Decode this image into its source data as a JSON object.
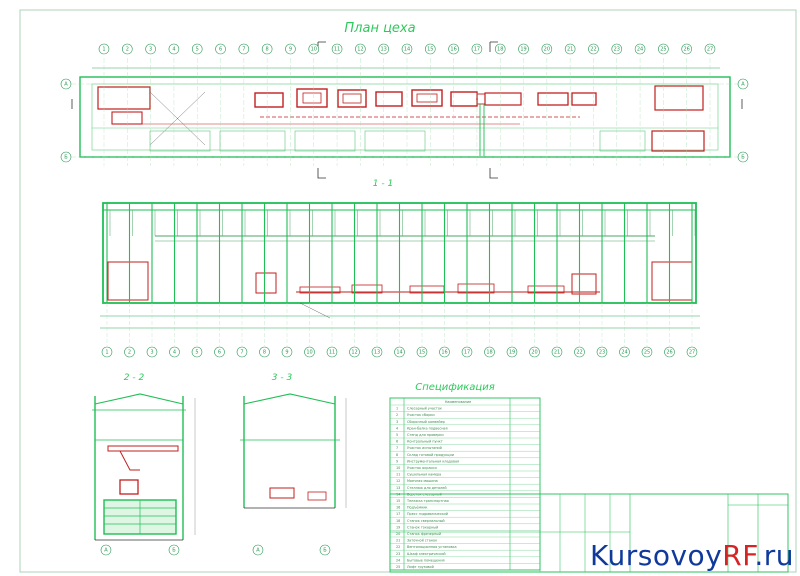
{
  "drawing": {
    "plan_title": "План цеха",
    "section_1": "1 - 1",
    "section_2": "2 - 2",
    "section_3": "3 - 3",
    "spec_title": "Спецификация",
    "spec_header": "Наименование",
    "spec_rows": [
      "Слесарный участок",
      "Участок сборки",
      "Сборочный конвейер",
      "Кран-балка подвесная",
      "Стенд для проверки",
      "Контрольный пункт",
      "Участок испытаний",
      "Склад готовой продукции",
      "Инструментальная кладовая",
      "Участок окраски",
      "Сушильная камера",
      "Моечная машина",
      "Стеллаж для деталей",
      "Верстак слесарный",
      "Тележка транспортная",
      "Подъёмник",
      "Пресс гидравлический",
      "Станок сверлильный",
      "Станок токарный",
      "Станок фрезерный",
      "Заточной станок",
      "Вентиляционная установка",
      "Шкаф электрический",
      "Бытовые помещения",
      "Лифт грузовой"
    ],
    "grid_top": [
      "1",
      "2",
      "3",
      "4",
      "5",
      "6",
      "7",
      "8",
      "9",
      "10",
      "11",
      "12",
      "13",
      "14",
      "15",
      "16",
      "17",
      "18",
      "19",
      "20",
      "21",
      "22",
      "23",
      "24",
      "25",
      "26",
      "27"
    ],
    "grid_bottom": [
      "1",
      "2",
      "3",
      "4",
      "5",
      "6",
      "7",
      "8",
      "9",
      "10",
      "11",
      "12",
      "13",
      "14",
      "15",
      "16",
      "17",
      "18",
      "19",
      "20",
      "21",
      "22",
      "23",
      "24",
      "25",
      "26",
      "27"
    ],
    "grid_rows": [
      "А",
      "Б"
    ],
    "grid_small_a": [
      "А",
      "Б"
    ],
    "grid_small_b": [
      "А",
      "Б"
    ]
  },
  "watermark": {
    "part1": "Kursovoy",
    "part2": "RF",
    "part3": ".ru"
  },
  "colors": {
    "green": "#1fbf55",
    "red": "#c21f1f",
    "grey": "#8a8a8a",
    "blue": "#0f3a9c"
  }
}
